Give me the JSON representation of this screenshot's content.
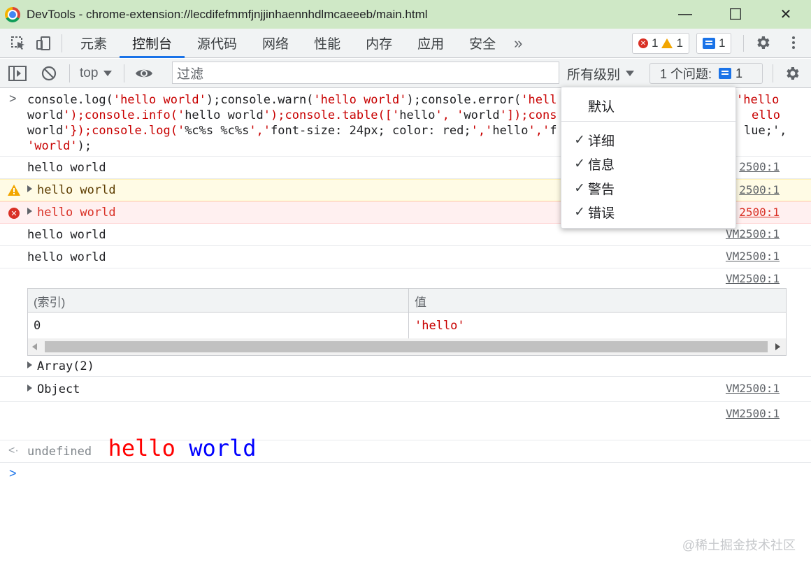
{
  "window": {
    "title": "DevTools - chrome-extension://lecdifefmmfjnjjinhaennhdlmcaeeeb/main.html",
    "minimize": "—",
    "maximize": "☐",
    "close": "✕"
  },
  "tabs": [
    "元素",
    "控制台",
    "源代码",
    "网络",
    "性能",
    "内存",
    "应用",
    "安全"
  ],
  "tab_more": "»",
  "badges": {
    "errors": "1",
    "warnings": "1",
    "messages": "1"
  },
  "console_toolbar": {
    "context": "top",
    "filter_placeholder": "过滤",
    "levels": "所有级别",
    "issues_label": "1 个问题:",
    "issues_count": "1"
  },
  "input": {
    "line1": "console.log(",
    "code_lines": [
      "console.log('hello world');console.warn('hello world');console.error('hell",
      "world');console.info('hello world');console.table(['hello', 'world']);cons",
      "world'});console.log('%c%s %c%s','font-size: 24px; color: red;','hello','f",
      "'world');"
    ],
    "code_right": [
      "'hello",
      "ello",
      "lue;',"
    ]
  },
  "messages": {
    "log1": "hello world",
    "warn": "hello world",
    "error": "hello world",
    "info": "hello world",
    "log2": "hello world",
    "source": "VM2500:1",
    "source_partial": "2500:1",
    "array": "Array(2)",
    "object": "Object",
    "styled_hello": "hello",
    "styled_world": "world",
    "result": "undefined"
  },
  "table": {
    "col_index": "(索引)",
    "col_value": "值",
    "rows": [
      {
        "index": "0",
        "value": "'hello'"
      }
    ]
  },
  "dropdown": {
    "default": "默认",
    "items": [
      "详细",
      "信息",
      "警告",
      "错误"
    ],
    "check": "✓"
  },
  "watermark": "@稀土掘金技术社区",
  "colors": {
    "accent": "#1a73e8",
    "error": "#d93025",
    "warning": "#f2a600",
    "titlebar": "#cfe8c6"
  }
}
